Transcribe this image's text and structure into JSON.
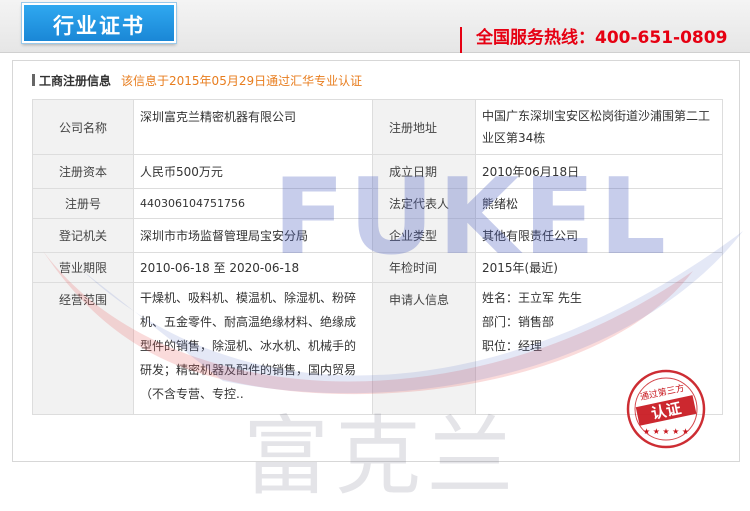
{
  "header": {
    "tab_label": "行业证书",
    "hotline_text": "全国服务热线：400-651-0809"
  },
  "section": {
    "title": "工商注册信息",
    "note": "该信息于2015年05月29日通过汇华专业认证"
  },
  "watermark": {
    "brand": "FUKEL",
    "brand_cn": "富克兰"
  },
  "table": {
    "rows": [
      {
        "label1": "公司名称",
        "value1": "深圳富克兰精密机器有限公司",
        "label2": "注册地址",
        "value2": "中国广东深圳宝安区松岗街道沙浦围第二工业区第34栋"
      },
      {
        "label1": "注册资本",
        "value1": "人民币500万元",
        "label2": "成立日期",
        "value2": "2010年06月18日"
      },
      {
        "label1": "注册号",
        "value1": "440306104751756",
        "label2": "法定代表人",
        "value2": "熊绪松"
      },
      {
        "label1": "登记机关",
        "value1": "深圳市市场监督管理局宝安分局",
        "label2": "企业类型",
        "value2": "其他有限责任公司"
      },
      {
        "label1": "营业期限",
        "value1": "2010-06-18 至 2020-06-18",
        "label2": "年检时间",
        "value2": "2015年(最近)"
      },
      {
        "label1": "经营范围",
        "value1": "干燥机、吸料机、模温机、除湿机、粉碎机、五金零件、耐高温绝缘材料、绝缘成型件的销售，除湿机、冰水机、机械手的研发；精密机器及配件的销售，国内贸易（不含专营、专控..",
        "label2": "申请人信息",
        "value2": ""
      }
    ],
    "applicant": {
      "name": "姓名：王立军 先生",
      "dept": "部门：销售部",
      "position": "职位：经理"
    }
  },
  "stamp": {
    "top_text": "通过第三方",
    "center_text": "认证"
  },
  "colors": {
    "tab_blue": "#1a87d6",
    "hotline_red": "#e60012",
    "note_orange": "#e87d1e",
    "stamp_red": "#c8161d"
  }
}
